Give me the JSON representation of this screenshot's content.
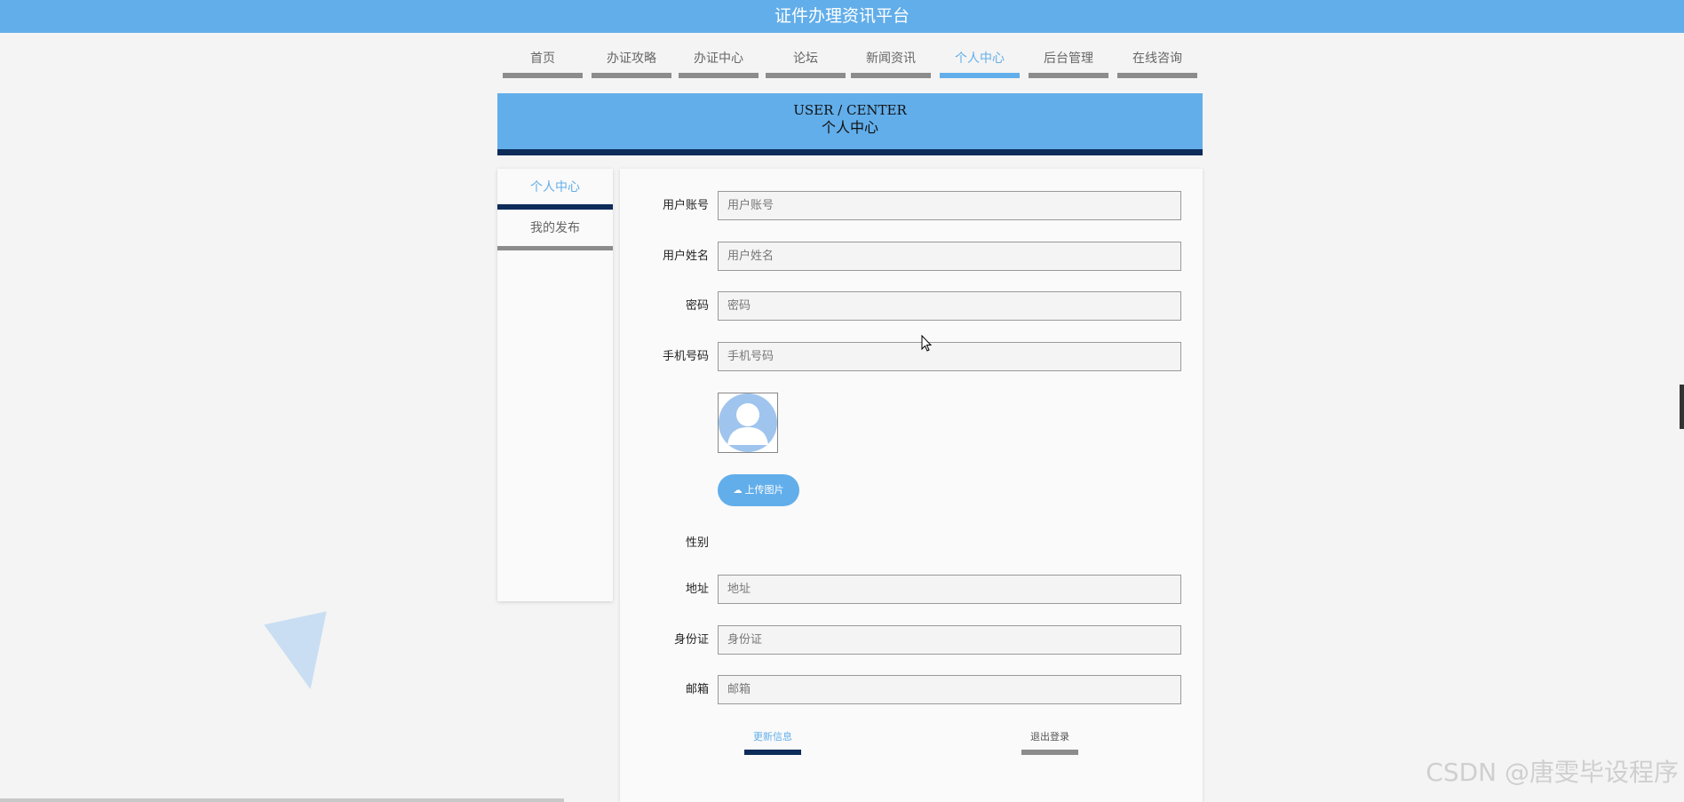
{
  "header": {
    "title": "证件办理资讯平台"
  },
  "nav": {
    "items": [
      {
        "label": "首页"
      },
      {
        "label": "办证攻略"
      },
      {
        "label": "办证中心"
      },
      {
        "label": "论坛"
      },
      {
        "label": "新闻资讯"
      },
      {
        "label": "个人中心"
      },
      {
        "label": "后台管理"
      },
      {
        "label": "在线咨询"
      }
    ],
    "active": "个人中心"
  },
  "banner": {
    "en": "USER / CENTER",
    "cn": "个人中心"
  },
  "sidebar": {
    "items": [
      {
        "label": "个人中心"
      },
      {
        "label": "我的发布"
      }
    ]
  },
  "form": {
    "fields": [
      {
        "label": "用户账号",
        "placeholder": "用户账号"
      },
      {
        "label": "用户姓名",
        "placeholder": "用户姓名"
      },
      {
        "label": "密码",
        "placeholder": "密码"
      },
      {
        "label": "手机号码",
        "placeholder": "手机号码"
      },
      {
        "label": "地址",
        "placeholder": "地址"
      },
      {
        "label": "身份证",
        "placeholder": "身份证"
      },
      {
        "label": "邮箱",
        "placeholder": "邮箱"
      }
    ],
    "upload_label": "上传图片",
    "gender_label": "性别",
    "update_label": "更新信息",
    "logout_label": "退出登录"
  },
  "watermark": "CSDN @唐雯毕设程序",
  "colors": {
    "primary": "#62aeea",
    "dark": "#0d2c5a",
    "background": "#f4f4f4"
  },
  "icons": {
    "upload": "cloud-upload-icon",
    "avatar": "user-avatar-icon"
  }
}
